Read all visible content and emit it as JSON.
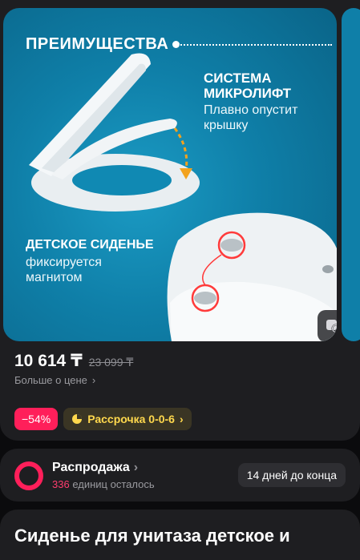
{
  "hero": {
    "advantages_title": "ПРЕИМУЩЕСТВА",
    "feature1_title_line1": "СИСТЕМА",
    "feature1_title_line2": "МИКРОЛИФТ",
    "feature1_desc_line1": "Плавно опустит",
    "feature1_desc_line2": "крышку",
    "feature2_title": "ДЕТСКОЕ СИДЕНЬЕ",
    "feature2_desc_line1": "фиксируется",
    "feature2_desc_line2": "магнитом",
    "search_icon": "image-search-icon"
  },
  "price": {
    "current": "10 614 ₸",
    "old": "23 099 ₸",
    "more_label": "Больше о цене"
  },
  "badges": {
    "discount": "−54%",
    "installment": "Рассрочка 0-0-6"
  },
  "sale": {
    "title": "Распродажа",
    "count": "336",
    "remaining_label": "единиц осталось",
    "timer": "14 дней до конца"
  },
  "product": {
    "title": "Сиденье для унитаза детское и"
  },
  "colors": {
    "accent": "#ff1f5a",
    "installment": "#ffd84d",
    "hero_bg": "#0f7fa8",
    "card_bg": "#1e1e21"
  }
}
